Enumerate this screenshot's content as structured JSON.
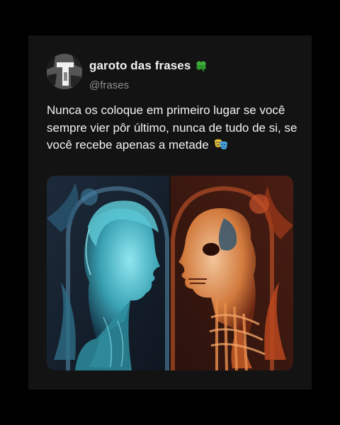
{
  "post": {
    "display_name": "garoto das frases",
    "name_emoji": "four-leaf-clover-icon",
    "handle": "@frases",
    "text": "Nunca os coloque em primeiro lugar se você sempre vier pôr último, nunca de tudo de si, se você recebe apenas a metade",
    "text_emoji": "performing-arts-masks-icon",
    "media": {
      "icon": "artwork-image",
      "left_tone": "#3bb8c4",
      "right_tone": "#e0652e"
    }
  },
  "colors": {
    "background": "#000000",
    "card": "#131313",
    "text_primary": "#f2f2f2",
    "text_secondary": "#8e8e8e"
  }
}
